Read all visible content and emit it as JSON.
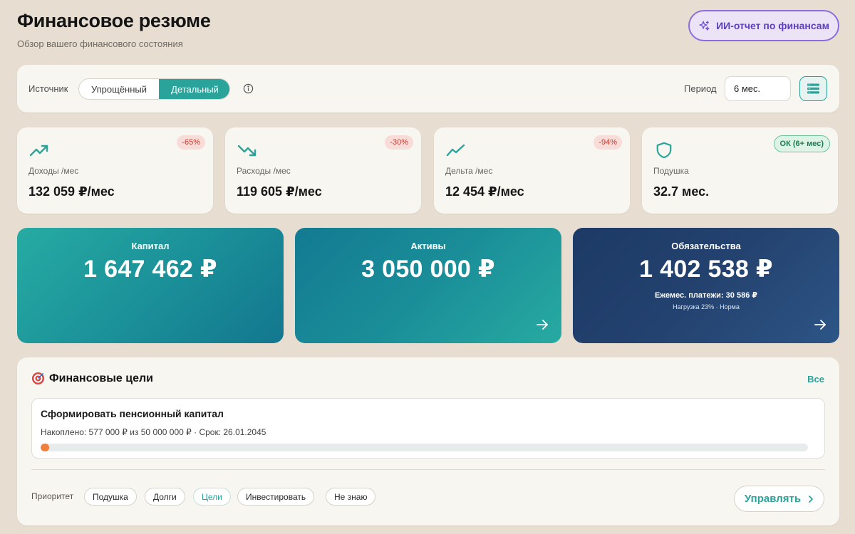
{
  "header": {
    "title": "Финансовое резюме",
    "subtitle": "Обзор вашего финансового состояния",
    "ai_button_label": "ИИ-отчет по финансам",
    "ai_button_icon": "sparkles-icon"
  },
  "filters": {
    "source_label": "Источник",
    "source_options": [
      "Упрощённый",
      "Детальный"
    ],
    "source_selected": "Детальный",
    "period_label": "Период",
    "period_value": "6 мес."
  },
  "stats": [
    {
      "label": "Доходы /мес",
      "value": "132 059 ₽/мес",
      "badge": "-65%",
      "icon": "trending-up-icon"
    },
    {
      "label": "Расходы /мес",
      "value": "119 605 ₽/мес",
      "badge": "-30%",
      "icon": "trending-down-icon"
    },
    {
      "label": "Дельта /мес",
      "value": "12 454 ₽/мес",
      "badge": "-94%",
      "icon": "line-chart-icon"
    },
    {
      "label": "Подушка",
      "value": "32.7 мес.",
      "badge": "ОК (6+ мес)",
      "icon": "shield-icon"
    }
  ],
  "summary": {
    "capital": {
      "title": "Капитал",
      "value": "1 647 462 ₽"
    },
    "assets": {
      "title": "Активы",
      "value": "3 050 000 ₽"
    },
    "liabilities": {
      "title": "Обязательства",
      "value": "1 402 538 ₽",
      "payments_label": "Ежемес. платежи:",
      "payments_value": "30 586 ₽",
      "load_note": "Нагрузка 23% · Норма"
    }
  },
  "goals": {
    "title": "Финансовые цели",
    "all_link": "Все",
    "items": [
      {
        "name": "Сформировать пенсионный капитал",
        "info": "Накоплено: 577 000 ₽ из 50 000 000 ₽ · Срок: 26.01.2045",
        "progress": 0.0115
      }
    ],
    "priority_label": "Приоритет",
    "priorities": [
      "Подушка",
      "Долги",
      "Цели",
      "Инвестировать",
      "Не знаю"
    ],
    "priority_active": "Цели",
    "manage_label": "Управлять"
  },
  "colors": {
    "accent": "#2aa39a",
    "ai_purple": "#8a6ee0",
    "negative_badge": "#c83d35",
    "positive_badge": "#1f7a4e",
    "progress": "#f07f3c",
    "liabilities_card": "#233f6e"
  }
}
